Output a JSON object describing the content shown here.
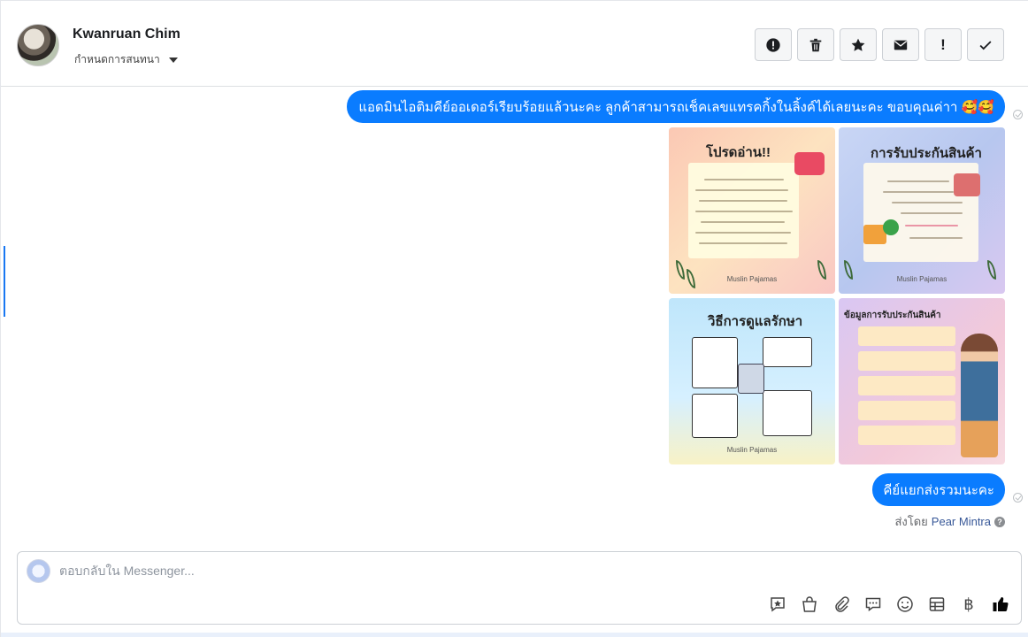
{
  "header": {
    "contact_name": "Kwanruan Chim",
    "assign_label": "กำหนดการสนทนา",
    "actions": [
      {
        "name": "report-spam",
        "icon": "alert-circle-icon"
      },
      {
        "name": "delete",
        "icon": "trash-icon"
      },
      {
        "name": "star",
        "icon": "star-icon"
      },
      {
        "name": "mark-unread",
        "icon": "envelope-icon"
      },
      {
        "name": "follow-up",
        "icon": "exclamation-icon",
        "glyph": "!"
      },
      {
        "name": "mark-done",
        "icon": "check-icon"
      }
    ]
  },
  "messages": {
    "message1": "แอดมินไอติมคีย์ออเดอร์เรียบร้อยแล้วนะคะ ลูกค้าสามารถเช็คเลขแทรคกิ้งในลิ้งค์ได้เลยนะคะ ขอบคุณค่าา 🥰🥰",
    "images": [
      {
        "title": "โปรดอ่าน!!",
        "footer": "Muslin Pajamas"
      },
      {
        "title": "การรับประกันสินค้า",
        "footer": "Muslin Pajamas"
      },
      {
        "title": "วิธีการดูแลรักษา",
        "footer": "Muslin Pajamas"
      },
      {
        "title": "ข้อมูลการรับประกันสินค้า",
        "footer": ""
      }
    ],
    "message2": "คีย์แยกส่งรวมนะคะ",
    "sent_by_prefix": "ส่งโดย",
    "sent_by_name": "Pear Mintra",
    "help_glyph": "?"
  },
  "composer": {
    "placeholder": "ตอบกลับใน Messenger...",
    "value": "",
    "tools": [
      "saved-reply-icon",
      "shopping-bag-icon",
      "paperclip-icon",
      "chat-bubble-icon",
      "emoji-icon",
      "table-icon",
      "baht-icon",
      "thumbs-up-icon"
    ],
    "baht_glyph": "฿"
  },
  "colors": {
    "bubble": "#0a7cff",
    "accent": "#1877f2",
    "thumbs_up": "#050505"
  }
}
